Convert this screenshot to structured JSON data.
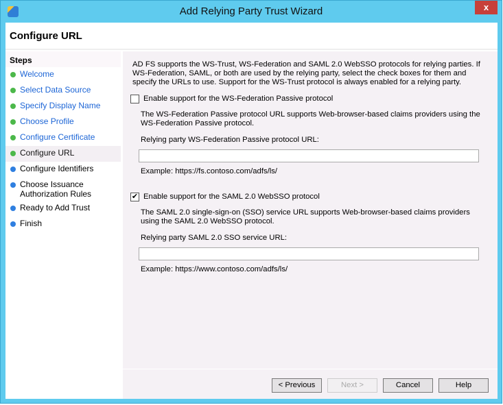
{
  "window": {
    "title": "Add Relying Party Trust Wizard",
    "close": "x"
  },
  "header": {
    "title": "Configure URL"
  },
  "steps": {
    "heading": "Steps",
    "items": [
      {
        "label": "Welcome",
        "state": "done"
      },
      {
        "label": "Select Data Source",
        "state": "done"
      },
      {
        "label": "Specify Display Name",
        "state": "done"
      },
      {
        "label": "Choose Profile",
        "state": "done"
      },
      {
        "label": "Configure Certificate",
        "state": "done"
      },
      {
        "label": "Configure URL",
        "state": "current"
      },
      {
        "label": "Configure Identifiers",
        "state": "todo"
      },
      {
        "label": "Choose Issuance Authorization Rules",
        "state": "todo"
      },
      {
        "label": "Ready to Add Trust",
        "state": "todo"
      },
      {
        "label": "Finish",
        "state": "todo"
      }
    ]
  },
  "main": {
    "intro": "AD FS supports the WS-Trust, WS-Federation and SAML 2.0 WebSSO protocols for relying parties.  If WS-Federation, SAML, or both are used by the relying party, select the check boxes for them and specify the URLs to use.  Support for the WS-Trust protocol is always enabled for a relying party.",
    "wsfed": {
      "checkbox_label": "Enable support for the WS-Federation Passive protocol",
      "checked": false,
      "description": "The WS-Federation Passive protocol URL supports Web-browser-based claims providers using the WS-Federation Passive protocol.",
      "field_label": "Relying party WS-Federation Passive protocol URL:",
      "value": "",
      "example": "Example: https://fs.contoso.com/adfs/ls/"
    },
    "saml": {
      "checkbox_label": "Enable support for the SAML 2.0 WebSSO protocol",
      "checked": true,
      "description": "The SAML 2.0 single-sign-on (SSO) service URL supports Web-browser-based claims providers using the SAML 2.0 WebSSO protocol.",
      "field_label": "Relying party SAML 2.0 SSO service URL:",
      "value": "",
      "example": "Example: https://www.contoso.com/adfs/ls/"
    }
  },
  "buttons": {
    "previous": "< Previous",
    "next": "Next >",
    "cancel": "Cancel",
    "help": "Help"
  }
}
